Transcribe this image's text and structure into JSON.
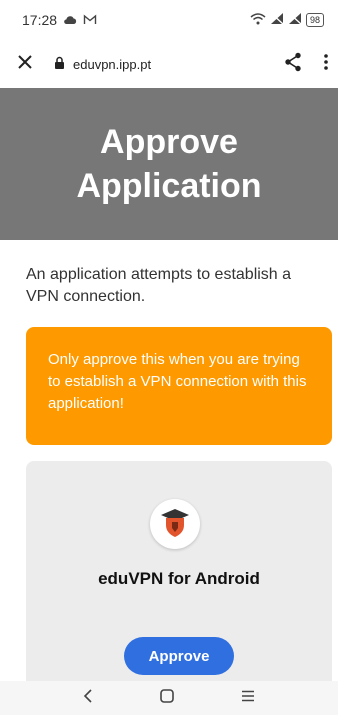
{
  "status_bar": {
    "time": "17:28",
    "battery": "98"
  },
  "browser": {
    "url": "eduvpn.ipp.pt",
    "icons": [
      "close-icon",
      "lock-icon",
      "share-icon",
      "more-vert-icon"
    ]
  },
  "page": {
    "heading": "Approve Application",
    "intro": "An application attempts to establish a VPN connection.",
    "warning": "Only approve this when you are trying to establish a VPN connection with this application!",
    "app_name": "eduVPN for Android",
    "approve_label": "Approve"
  },
  "colors": {
    "hero_bg": "#777777",
    "warning_bg": "#fe9a00",
    "card_bg": "#ececec",
    "button_bg": "#2f6fe0"
  },
  "nav_bar": {
    "icons": [
      "back-icon",
      "home-icon",
      "recents-icon"
    ]
  }
}
